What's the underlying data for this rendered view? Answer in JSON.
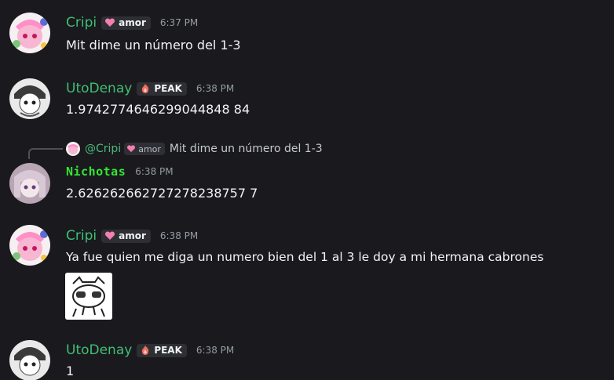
{
  "colors": {
    "background": "#1a1a1e",
    "cripi_name": "#3fbf74",
    "utodenay_name": "#3fbf74",
    "nichotas_name": "#33e633",
    "timestamp": "#949ba4",
    "message_text": "#f2f3f5"
  },
  "messages": [
    {
      "username": "Cripi",
      "tag": "amor",
      "tag_icon": "pink-heart-icon",
      "timestamp": "6:37 PM",
      "text": "Mit dime un número del 1-3"
    },
    {
      "username": "UtoDenay",
      "tag": "PEAK",
      "tag_icon": "flame-icon",
      "timestamp": "6:38 PM",
      "text": "1.9742774646299044848 84"
    },
    {
      "reply": {
        "mention": "@Cripi",
        "tag": "amor",
        "text": "Mit dime un número del 1-3"
      },
      "username": "Nichotas",
      "timestamp": "6:38 PM",
      "text": "2.626262662727278238757 7"
    },
    {
      "username": "Cripi",
      "tag": "amor",
      "tag_icon": "pink-heart-icon",
      "timestamp": "6:38 PM",
      "text": "Ya fue quien me diga un numero bien del 1 al 3 le doy a mi hermana cabrones",
      "image": "meme-face-sticker"
    },
    {
      "username": "UtoDenay",
      "tag": "PEAK",
      "tag_icon": "flame-icon",
      "timestamp": "6:38 PM",
      "text": "1"
    }
  ]
}
